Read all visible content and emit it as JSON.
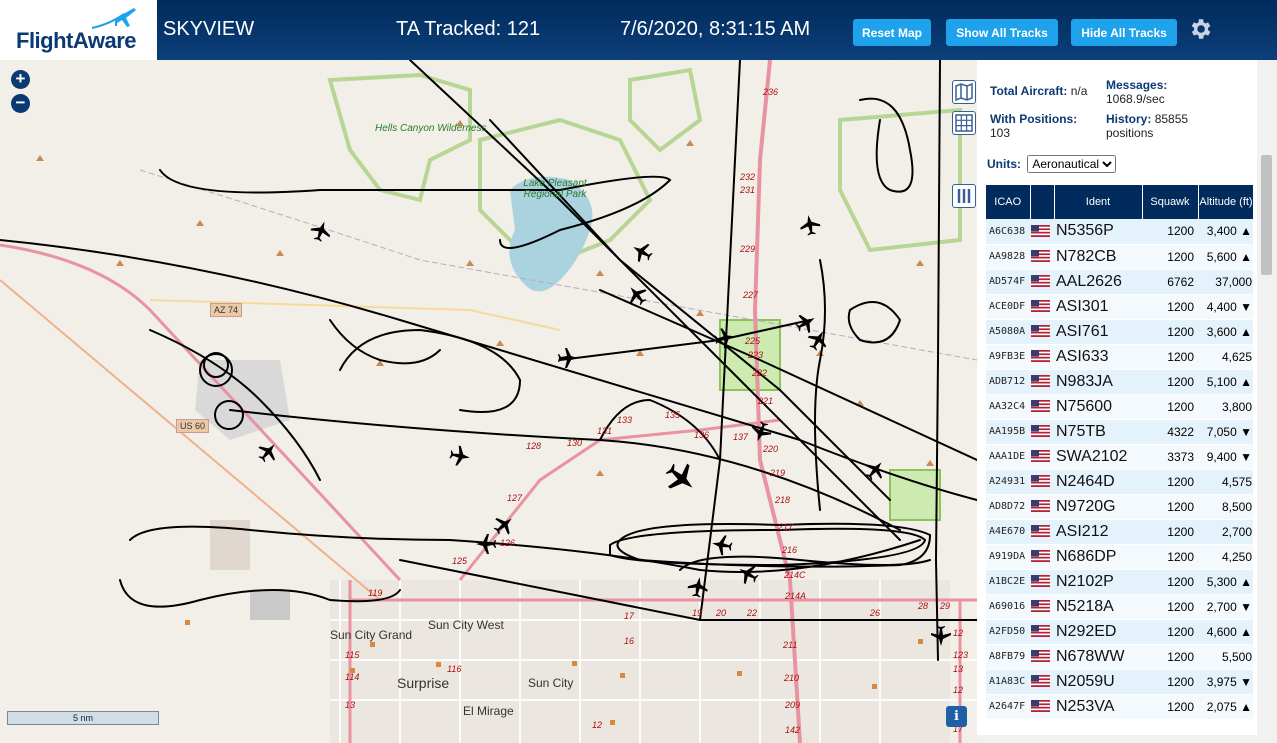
{
  "header": {
    "logo_text": "FlightAware",
    "app_title": "SKYVIEW",
    "ta_tracked": "TA Tracked: 121",
    "clock": "7/6/2020, 8:31:15 AM",
    "reset_map": "Reset Map",
    "show_all_tracks": "Show All Tracks",
    "hide_all_tracks": "Hide All Tracks",
    "settings_icon": "gear-icon"
  },
  "colors": {
    "header_bg": "#002b5c",
    "button": "#1fa2ec",
    "track": "#000000",
    "map_bg": "#f2efe9",
    "water": "#aad3df",
    "park": "#8fc35a"
  },
  "map": {
    "zoom_in": "+",
    "zoom_out": "−",
    "scale": "5 nm",
    "info": "i",
    "places": {
      "sun_city_grand": "Sun City Grand",
      "sun_city_west": "Sun City West",
      "surprise": "Surprise",
      "sun_city": "Sun City",
      "el_mirage": "El Mirage",
      "hells_canyon": "Hells Canyon Wilderness",
      "lake_pleasant": "Lake Pleasant Regional Park"
    },
    "roads": {
      "az74": "AZ 74",
      "us60": "US 60"
    },
    "mile_markers": [
      "236",
      "232",
      "231",
      "229",
      "227",
      "225",
      "223",
      "222",
      "221",
      "220",
      "219",
      "218",
      "217",
      "216",
      "214C",
      "214A",
      "211",
      "210",
      "209",
      "142",
      "116",
      "115",
      "114",
      "13",
      "12",
      "123",
      "125",
      "126",
      "127",
      "128",
      "130",
      "131",
      "133",
      "135",
      "136",
      "137",
      "119",
      "17",
      "19",
      "20",
      "22",
      "26",
      "28",
      "29",
      "13",
      "12",
      "11",
      "17",
      "16",
      "12"
    ]
  },
  "sidebar": {
    "total_aircraft_label": "Total Aircraft:",
    "total_aircraft_value": "n/a",
    "messages_label": "Messages:",
    "messages_value": "1068.9/sec",
    "with_positions_label": "With Positions:",
    "with_positions_value": "103",
    "history_label": "History:",
    "history_value": "85855 positions",
    "units_label": "Units:",
    "units_selected": "Aeronautical",
    "columns": [
      "ICAO",
      "Ident",
      "Squawk",
      "Altitude (ft)"
    ],
    "rows": [
      {
        "icao": "A6C638",
        "ident": "N5356P",
        "squawk": "1200",
        "alt": "3,400 ▲"
      },
      {
        "icao": "AA9828",
        "ident": "N782CB",
        "squawk": "1200",
        "alt": "5,600 ▲"
      },
      {
        "icao": "AD574F",
        "ident": "AAL2626",
        "squawk": "6762",
        "alt": "37,000"
      },
      {
        "icao": "ACE0DF",
        "ident": "ASI301",
        "squawk": "1200",
        "alt": "4,400 ▼"
      },
      {
        "icao": "A5080A",
        "ident": "ASI761",
        "squawk": "1200",
        "alt": "3,600 ▲"
      },
      {
        "icao": "A9FB3E",
        "ident": "ASI633",
        "squawk": "1200",
        "alt": "4,625"
      },
      {
        "icao": "ADB712",
        "ident": "N983JA",
        "squawk": "1200",
        "alt": "5,100 ▲"
      },
      {
        "icao": "AA32C4",
        "ident": "N75600",
        "squawk": "1200",
        "alt": "3,800"
      },
      {
        "icao": "AA195B",
        "ident": "N75TB",
        "squawk": "4322",
        "alt": "7,050 ▼"
      },
      {
        "icao": "AAA1DE",
        "ident": "SWA2102",
        "squawk": "3373",
        "alt": "9,400 ▼"
      },
      {
        "icao": "A24931",
        "ident": "N2464D",
        "squawk": "1200",
        "alt": "4,575"
      },
      {
        "icao": "AD8D72",
        "ident": "N9720G",
        "squawk": "1200",
        "alt": "8,500"
      },
      {
        "icao": "A4E670",
        "ident": "ASI212",
        "squawk": "1200",
        "alt": "2,700"
      },
      {
        "icao": "A919DA",
        "ident": "N686DP",
        "squawk": "1200",
        "alt": "4,250"
      },
      {
        "icao": "A1BC2E",
        "ident": "N2102P",
        "squawk": "1200",
        "alt": "5,300 ▲"
      },
      {
        "icao": "A69016",
        "ident": "N5218A",
        "squawk": "1200",
        "alt": "2,700 ▼"
      },
      {
        "icao": "A2FD50",
        "ident": "N292ED",
        "squawk": "1200",
        "alt": "4,600 ▲"
      },
      {
        "icao": "A8FB79",
        "ident": "N678WW",
        "squawk": "1200",
        "alt": "5,500"
      },
      {
        "icao": "A1A83C",
        "ident": "N2059U",
        "squawk": "1200",
        "alt": "3,975 ▼"
      },
      {
        "icao": "A2647F",
        "ident": "N253VA",
        "squawk": "1200",
        "alt": "2,075 ▲"
      }
    ]
  }
}
